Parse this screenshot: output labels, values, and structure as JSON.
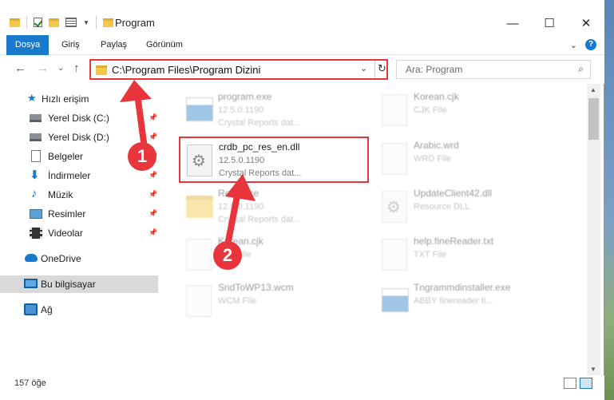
{
  "window": {
    "title": "Program",
    "controls": {
      "minimize": "—",
      "maximize": "☐",
      "close": "✕"
    }
  },
  "ribbon": {
    "tabs": [
      "Dosya",
      "Giriş",
      "Paylaş",
      "Görünüm"
    ],
    "help": "?",
    "expand": "⌄"
  },
  "nav": {
    "back": "←",
    "forward": "→",
    "recent": "⌄",
    "up": "↑",
    "address": "C:\\Program Files\\Program Dizini",
    "refresh": "↻",
    "search_placeholder": "Ara: Program",
    "search_icon": "⌕",
    "dropdown": "⌄"
  },
  "sidebar": {
    "items": [
      {
        "label": "Hızlı erişim",
        "icon": "star-icon"
      },
      {
        "label": "Yerel Disk (C:)",
        "icon": "drive-icon",
        "pinned": true
      },
      {
        "label": "Yerel Disk (D:)",
        "icon": "drive-icon",
        "pinned": true
      },
      {
        "label": "Belgeler",
        "icon": "documents-icon",
        "pinned": true
      },
      {
        "label": "İndirmeler",
        "icon": "downloads-icon",
        "pinned": true
      },
      {
        "label": "Müzik",
        "icon": "music-icon",
        "pinned": true
      },
      {
        "label": "Resimler",
        "icon": "pictures-icon",
        "pinned": true
      },
      {
        "label": "Videolar",
        "icon": "videos-icon",
        "pinned": true
      },
      {
        "label": "OneDrive",
        "icon": "onedrive-icon"
      },
      {
        "label": "Bu bilgisayar",
        "icon": "computer-icon",
        "selected": true
      },
      {
        "label": "Ağ",
        "icon": "network-icon"
      }
    ],
    "pin_glyph": "📌"
  },
  "files": [
    {
      "name": "program.exe",
      "line2": "12.5.0.1190",
      "line3": "Crystal Reports dat...",
      "icon": "exe-icon",
      "faded": true
    },
    {
      "name": "Korean.cjk",
      "line2": "CJK File",
      "line3": "",
      "icon": "file-icon",
      "faded": true
    },
    {
      "name": "crdb_pc_res_en.dll",
      "line2": "12.5.0.1190",
      "line3": "Crystal Reports dat...",
      "icon": "dll-gear-icon",
      "faded": false,
      "highlighted": true
    },
    {
      "name": "Arabic.wrd",
      "line2": "WRD File",
      "line3": "",
      "icon": "file-icon",
      "faded": true
    },
    {
      "name": "Resource",
      "line2": "12.5.0.1190",
      "line3": "Crystal Reports dat...",
      "icon": "folder-icon",
      "faded": true
    },
    {
      "name": "UpdateClient42.dll",
      "line2": "Resource DLL",
      "line3": "",
      "icon": "dll-gear-icon",
      "faded": true
    },
    {
      "name": "Korean.cjk",
      "line2": "CJK File",
      "line3": "",
      "icon": "file-icon",
      "faded": true
    },
    {
      "name": "help.fineReader.txt",
      "line2": "TXT File",
      "line3": "",
      "icon": "file-icon",
      "faded": true
    },
    {
      "name": "SndToWP13.wcm",
      "line2": "WCM File",
      "line3": "",
      "icon": "file-icon",
      "faded": true
    },
    {
      "name": "Tngrammdinstaller.exe",
      "line2": "ABBY finereader ti...",
      "line3": "",
      "icon": "exe-icon",
      "faded": true
    }
  ],
  "status": {
    "count": "157 öğe"
  },
  "annotations": {
    "badge1": "1",
    "badge2": "2",
    "color": "#e8343b"
  },
  "colors": {
    "accent": "#1979ca",
    "highlight": "#e8343b"
  }
}
